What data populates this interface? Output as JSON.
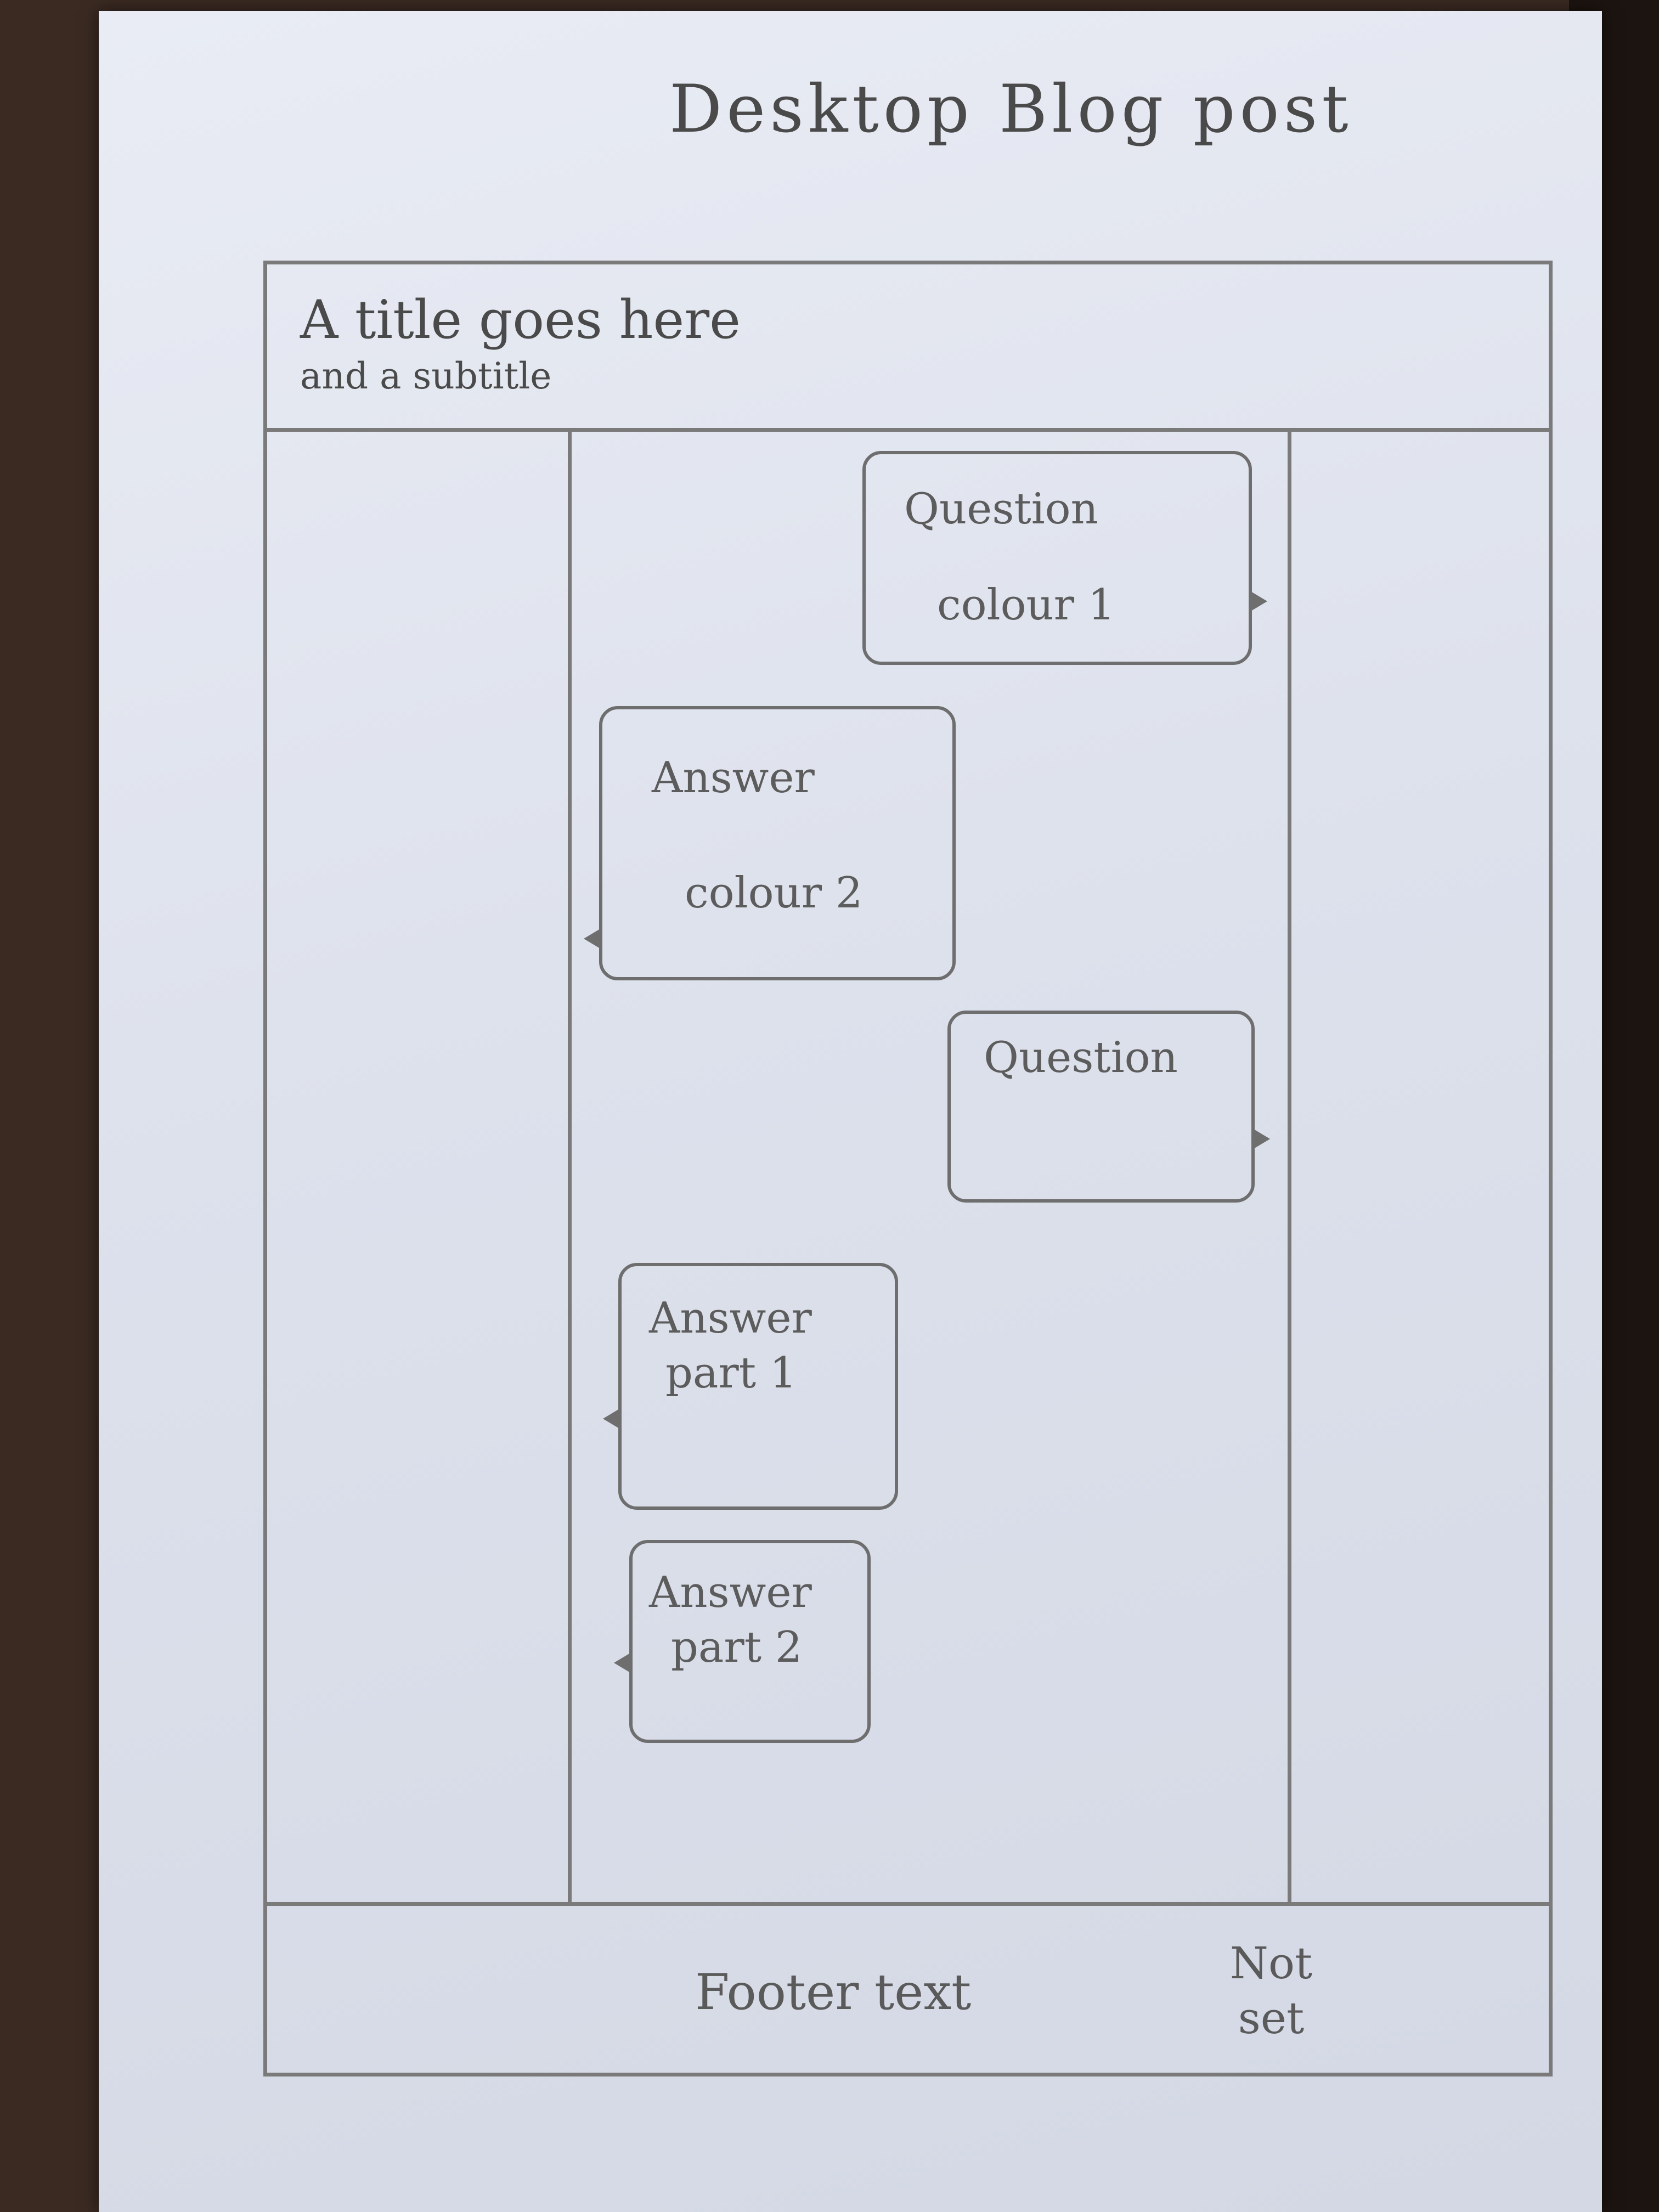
{
  "page_title": "Desktop Blog post",
  "header": {
    "title": "A title goes here",
    "subtitle": "and a subtitle"
  },
  "chat": {
    "messages": [
      {
        "role": "question",
        "lines": [
          "Question",
          "colour 1"
        ]
      },
      {
        "role": "answer",
        "lines": [
          "Answer",
          "colour 2"
        ]
      },
      {
        "role": "question",
        "lines": [
          "Question"
        ]
      },
      {
        "role": "answer",
        "lines": [
          "Answer",
          "part 1"
        ]
      },
      {
        "role": "answer",
        "lines": [
          "Answer",
          "part 2"
        ]
      }
    ]
  },
  "footer": {
    "text": "Footer text",
    "note_line1": "Not",
    "note_line2": "set"
  }
}
